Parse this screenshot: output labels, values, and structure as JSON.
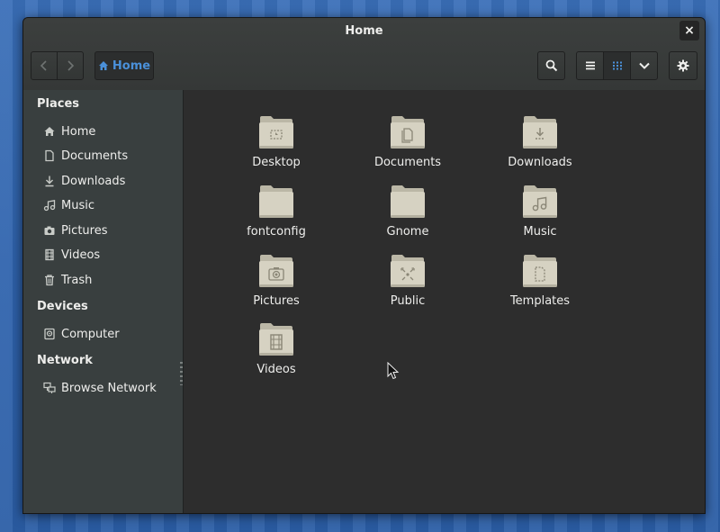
{
  "window": {
    "title": "Home",
    "close_glyph": "×"
  },
  "toolbar": {
    "back_icon": "chevron-left-icon",
    "forward_icon": "chevron-right-icon",
    "path_label": "Home",
    "search_icon": "search-icon",
    "list_view_icon": "list-view-icon",
    "grid_view_icon": "grid-view-icon",
    "view_menu_icon": "chevron-down-icon",
    "settings_icon": "gear-icon"
  },
  "sidebar": {
    "places_title": "Places",
    "places": [
      {
        "label": "Home",
        "icon": "home-icon"
      },
      {
        "label": "Documents",
        "icon": "document-icon"
      },
      {
        "label": "Downloads",
        "icon": "download-icon"
      },
      {
        "label": "Music",
        "icon": "music-icon"
      },
      {
        "label": "Pictures",
        "icon": "camera-icon"
      },
      {
        "label": "Videos",
        "icon": "film-icon"
      },
      {
        "label": "Trash",
        "icon": "trash-icon"
      }
    ],
    "devices_title": "Devices",
    "devices": [
      {
        "label": "Computer",
        "icon": "drive-icon"
      }
    ],
    "network_title": "Network",
    "network": [
      {
        "label": "Browse Network",
        "icon": "network-icon"
      }
    ]
  },
  "files": [
    {
      "label": "Desktop",
      "icon": "folder-desktop-icon"
    },
    {
      "label": "Documents",
      "icon": "folder-documents-icon"
    },
    {
      "label": "Downloads",
      "icon": "folder-downloads-icon"
    },
    {
      "label": "fontconfig",
      "icon": "folder-icon"
    },
    {
      "label": "Gnome",
      "icon": "folder-icon"
    },
    {
      "label": "Music",
      "icon": "folder-music-icon"
    },
    {
      "label": "Pictures",
      "icon": "folder-pictures-icon"
    },
    {
      "label": "Public",
      "icon": "folder-public-icon"
    },
    {
      "label": "Templates",
      "icon": "folder-templates-icon"
    },
    {
      "label": "Videos",
      "icon": "folder-videos-icon"
    }
  ],
  "colors": {
    "accent": "#4a90d9",
    "folder": "#d6d2c2",
    "text": "#eeeeec"
  }
}
